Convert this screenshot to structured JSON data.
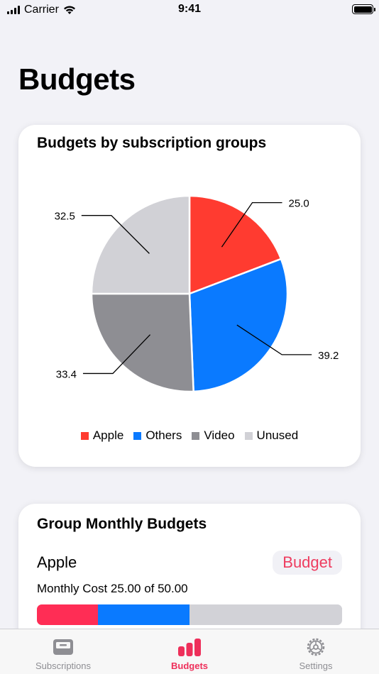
{
  "status_bar": {
    "carrier": "Carrier",
    "time": "9:41"
  },
  "page": {
    "title": "Budgets"
  },
  "pie_card": {
    "title": "Budgets by subscription groups",
    "legend": [
      "Apple",
      "Others",
      "Video",
      "Unused"
    ]
  },
  "chart_data": {
    "type": "pie",
    "title": "Budgets by subscription groups",
    "labels": [
      "Apple",
      "Others",
      "Video",
      "Unused"
    ],
    "values": [
      25.0,
      39.2,
      33.4,
      32.5
    ],
    "value_labels": [
      "25.0",
      "39.2",
      "33.4",
      "32.5"
    ],
    "colors": [
      "#ff3b30",
      "#0a7aff",
      "#8e8e93",
      "#d1d1d6"
    ],
    "legend_position": "bottom"
  },
  "budget_card": {
    "title": "Group Monthly Budgets",
    "group_name": "Apple",
    "button_label": "Budget",
    "monthly_cost_text": "Monthly Cost 25.00 of 50.00",
    "progress": [
      {
        "fraction": 0.2,
        "color": "#ff2d55"
      },
      {
        "fraction": 0.3,
        "color": "#0a7aff"
      },
      {
        "fraction": 0.5,
        "color": "#d2d2d7"
      }
    ]
  },
  "tab_bar": {
    "tabs": [
      {
        "label": "Subscriptions",
        "icon": "tray-icon",
        "active": false
      },
      {
        "label": "Budgets",
        "icon": "bar-chart-icon",
        "active": true
      },
      {
        "label": "Settings",
        "icon": "gear-icon",
        "active": false
      }
    ]
  }
}
